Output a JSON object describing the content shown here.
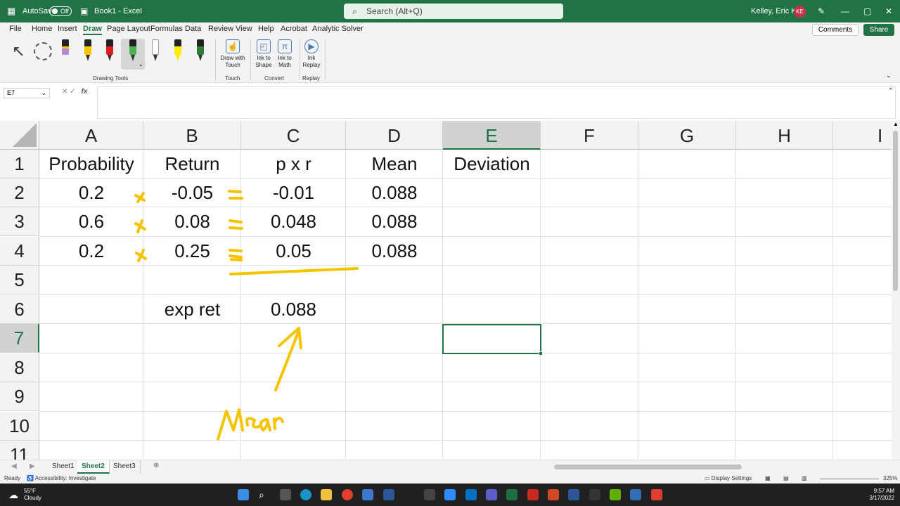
{
  "titlebar": {
    "autosave_label": "AutoSave",
    "autosave_state": "Off",
    "doc_title": "Book1 - Excel",
    "search_placeholder": "Search (Alt+Q)",
    "user_name": "Kelley, Eric Kyle",
    "user_initials": "KE"
  },
  "menu": {
    "items": [
      "File",
      "Home",
      "Insert",
      "Draw",
      "Page Layout",
      "Formulas",
      "Data",
      "Review",
      "View",
      "Help",
      "Acrobat",
      "Analytic Solver"
    ],
    "active": "Draw",
    "comments_label": "Comments",
    "share_label": "Share"
  },
  "ribbon": {
    "drawing_tools_label": "Drawing Tools",
    "touch_label": "Touch",
    "convert_label": "Convert",
    "replay_label": "Replay",
    "draw_with_touch": "Draw with Touch",
    "ink_to_shape": "Ink to Shape",
    "ink_to_math": "Ink to Math",
    "ink_replay": "Ink Replay",
    "pen_colors": [
      "#7b3fa0",
      "#f5c400",
      "#e01c1c",
      "#4caf50",
      "#222222",
      "#ffeb00",
      "#2e7d32"
    ]
  },
  "formula_bar": {
    "name_box": "E7",
    "fx": "fx",
    "content": ""
  },
  "sheet": {
    "columns": [
      "A",
      "B",
      "C",
      "D",
      "E",
      "F",
      "G",
      "H",
      "I"
    ],
    "selected_column": "E",
    "rows": [
      "1",
      "2",
      "3",
      "4",
      "5",
      "6",
      "7",
      "8",
      "9",
      "10",
      "11"
    ],
    "selected_row": "7",
    "selected_cell": "E7",
    "cells": {
      "A1": "Probability",
      "B1": "Return",
      "C1": "p x r",
      "D1": "Mean",
      "E1": "Deviation",
      "A2": "0.2",
      "B2": "-0.05",
      "C2": "-0.01",
      "D2": "0.088",
      "A3": "0.6",
      "B3": "0.08",
      "C3": "0.048",
      "D3": "0.088",
      "A4": "0.2",
      "B4": "0.25",
      "C4": "0.05",
      "D4": "0.088",
      "B6": "exp ret",
      "C6": "0.088"
    }
  },
  "sheet_tabs": {
    "tabs": [
      "Sheet1",
      "Sheet2",
      "Sheet3"
    ],
    "active": "Sheet2"
  },
  "statusbar": {
    "ready": "Ready",
    "accessibility": "Accessibility: Investigate",
    "display_settings": "Display Settings",
    "zoom": "325%"
  },
  "taskbar": {
    "temperature": "55°F",
    "weather": "Cloudy",
    "time": "9:57 AM",
    "date": "3/17/2022"
  },
  "ink": {
    "color": "#f5c400",
    "handwritten_word": "Mean"
  }
}
